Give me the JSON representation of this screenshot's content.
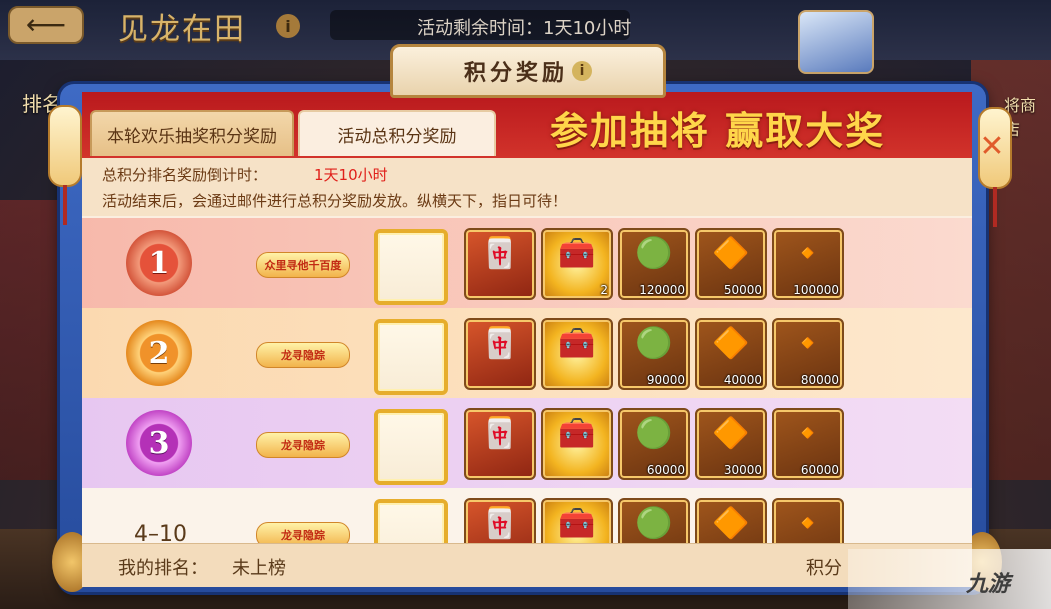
{
  "header": {
    "back_icon": "back-arrow-icon",
    "event_title": "见龙在田",
    "info_icon": "i",
    "remaining_time": "活动剩余时间：1天10小时"
  },
  "side": {
    "rank_label": "排名",
    "shop_label": "将商店"
  },
  "popup": {
    "title": "积分奖励",
    "title_info": "i",
    "close_glyph": "✕",
    "banner": "参加抽将  赢取大奖",
    "tabs": [
      {
        "label": "本轮欢乐抽奖积分奖励",
        "active": false
      },
      {
        "label": "活动总积分奖励",
        "active": true
      }
    ],
    "countdown_label": "总积分排名奖励倒计时：",
    "countdown_value": "1天10小时",
    "notice": "活动结束后，会通过邮件进行总积分奖励发放。纵横天下，指日可待！"
  },
  "ranks": [
    {
      "rank": "1",
      "title_badge": "众里寻他千百度",
      "rewards": [
        {
          "icon": "card-icon",
          "glyph": "🀄",
          "qty": ""
        },
        {
          "icon": "chest-icon",
          "glyph": "🧰",
          "qty": "2"
        },
        {
          "icon": "jade-icon",
          "glyph": "🟢",
          "qty": "120000"
        },
        {
          "icon": "gem-icon",
          "glyph": "🔶",
          "qty": "50000"
        },
        {
          "icon": "ingot-icon",
          "glyph": "🔸",
          "qty": "100000"
        }
      ]
    },
    {
      "rank": "2",
      "title_badge": "龙寻隐踪",
      "rewards": [
        {
          "icon": "card-icon",
          "glyph": "🀄",
          "qty": ""
        },
        {
          "icon": "chest-icon",
          "glyph": "🧰",
          "qty": ""
        },
        {
          "icon": "jade-icon",
          "glyph": "🟢",
          "qty": "90000"
        },
        {
          "icon": "gem-icon",
          "glyph": "🔶",
          "qty": "40000"
        },
        {
          "icon": "ingot-icon",
          "glyph": "🔸",
          "qty": "80000"
        }
      ]
    },
    {
      "rank": "3",
      "title_badge": "龙寻隐踪",
      "rewards": [
        {
          "icon": "card-icon",
          "glyph": "🀄",
          "qty": ""
        },
        {
          "icon": "chest-icon",
          "glyph": "🧰",
          "qty": ""
        },
        {
          "icon": "jade-icon",
          "glyph": "🟢",
          "qty": "60000"
        },
        {
          "icon": "gem-icon",
          "glyph": "🔶",
          "qty": "30000"
        },
        {
          "icon": "ingot-icon",
          "glyph": "🔸",
          "qty": "60000"
        }
      ]
    },
    {
      "rank": "4–10",
      "title_badge": "龙寻隐踪",
      "rewards": [
        {
          "icon": "card-icon",
          "glyph": "🀄",
          "qty": ""
        },
        {
          "icon": "chest-icon",
          "glyph": "🧰",
          "qty": ""
        },
        {
          "icon": "jade-icon",
          "glyph": "🟢",
          "qty": ""
        },
        {
          "icon": "gem-icon",
          "glyph": "🔶",
          "qty": ""
        },
        {
          "icon": "ingot-icon",
          "glyph": "🔸",
          "qty": ""
        }
      ]
    }
  ],
  "my_rank": {
    "label": "我的排名：",
    "value": "未上榜",
    "score_label": "积分"
  },
  "watermark": {
    "text": "九游"
  }
}
